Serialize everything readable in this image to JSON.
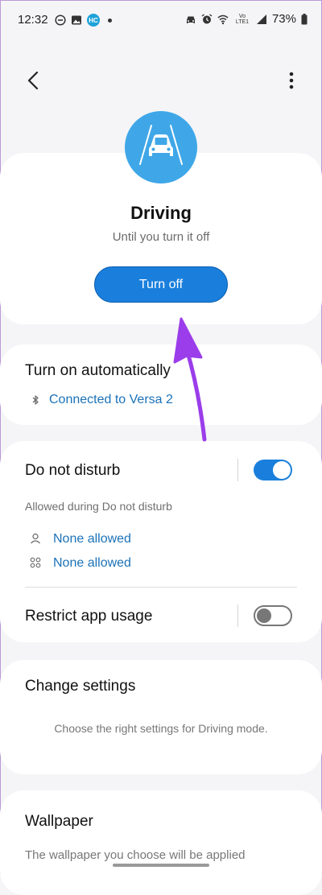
{
  "status_bar": {
    "time": "12:32",
    "badge_text": "HC",
    "network_text": "Vo LTE1",
    "battery": "73%"
  },
  "mode": {
    "title": "Driving",
    "subtitle": "Until you turn it off",
    "turn_off_label": "Turn off"
  },
  "auto": {
    "title": "Turn on automatically",
    "connected_label": "Connected to Versa 2"
  },
  "dnd": {
    "title": "Do not disturb",
    "enabled": true,
    "allowed_heading": "Allowed during Do not disturb",
    "people_label": "None allowed",
    "apps_label": "None allowed"
  },
  "restrict": {
    "title": "Restrict app usage",
    "enabled": false
  },
  "change": {
    "title": "Change settings",
    "description": "Choose the right settings for Driving mode."
  },
  "wallpaper": {
    "title": "Wallpaper",
    "description": "The wallpaper you choose will be applied"
  },
  "colors": {
    "accent": "#1a7fdc",
    "mode_icon_bg": "#3fa7e8",
    "link": "#1b72b8",
    "annotation": "#9b3dea"
  }
}
